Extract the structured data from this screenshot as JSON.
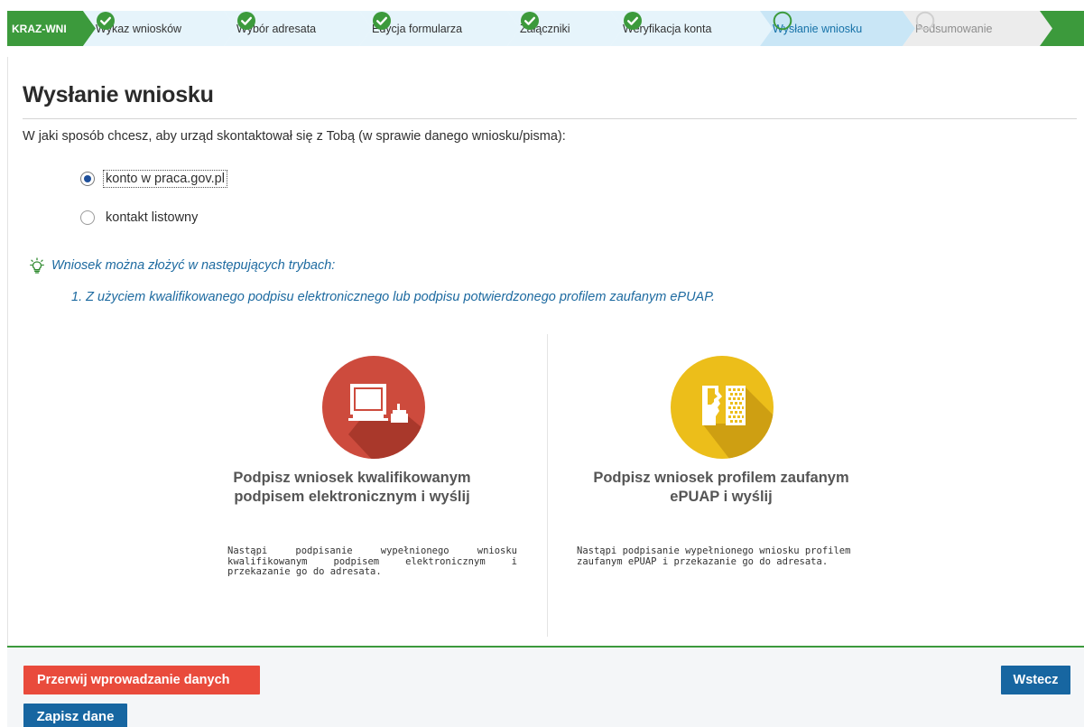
{
  "colors": {
    "brand_green": "#3c9a3c",
    "step_done_bg": "#e6f4fb",
    "step_current_bg": "#c9e6f6",
    "step_future_bg": "#ececec",
    "accent_blue": "#1766a1",
    "danger_red": "#e94b3c",
    "qualified_circle": "#cd4b3d",
    "epuap_circle": "#ecbe1a"
  },
  "wizard": {
    "brand": "KRAZ-WNI",
    "steps": [
      {
        "label": "Wykaz wniosków",
        "state": "done",
        "icon": "check-circle-icon"
      },
      {
        "label": "Wybór adresata",
        "state": "done",
        "icon": "check-circle-icon"
      },
      {
        "label": "Edycja formularza",
        "state": "done",
        "icon": "check-circle-icon"
      },
      {
        "label": "Załączniki",
        "state": "done",
        "icon": "check-circle-icon"
      },
      {
        "label": "Weryfikacja konta",
        "state": "done",
        "icon": "check-circle-icon"
      },
      {
        "label": "Wysłanie wniosku",
        "state": "current",
        "icon": "empty-circle-icon"
      },
      {
        "label": "Podsumowanie",
        "state": "future",
        "icon": "empty-circle-icon"
      }
    ]
  },
  "page": {
    "title": "Wysłanie wniosku",
    "question": "W jaki sposób chcesz, aby urząd skontaktował się z Tobą (w sprawie danego wniosku/pisma):",
    "contact_options": [
      {
        "label": "konto w praca.gov.pl",
        "selected": true
      },
      {
        "label": "kontakt listowny",
        "selected": false
      }
    ],
    "hint": {
      "icon": "lightbulb-icon",
      "text": "Wniosek można złożyć w następujących trybach:",
      "item": "1. Z użyciem kwalifikowanego podpisu elektronicznego lub podpisu potwierdzonego profilem zaufanym ePUAP."
    }
  },
  "signing": {
    "qualified": {
      "icon": "computer-seal-icon",
      "title_line1": "Podpisz wniosek kwalifikowanym",
      "title_line2": "podpisem elektronicznym i wyślij",
      "desc": "Nastąpi podpisanie wypełnionego wniosku kwalifikowanym podpisem elektronicznym i przekazanie go do adresata."
    },
    "epuap": {
      "icon": "profile-scan-icon",
      "title_line1": "Podpisz wniosek profilem zaufanym",
      "title_line2": "ePUAP i wyślij",
      "desc": "Nastąpi podpisanie wypełnionego wniosku profilem zaufanym ePUAP i przekazanie go do adresata."
    }
  },
  "footer": {
    "cancel_label": "Przerwij wprowadzanie danych",
    "back_label": "Wstecz",
    "save_label": "Zapisz dane"
  }
}
